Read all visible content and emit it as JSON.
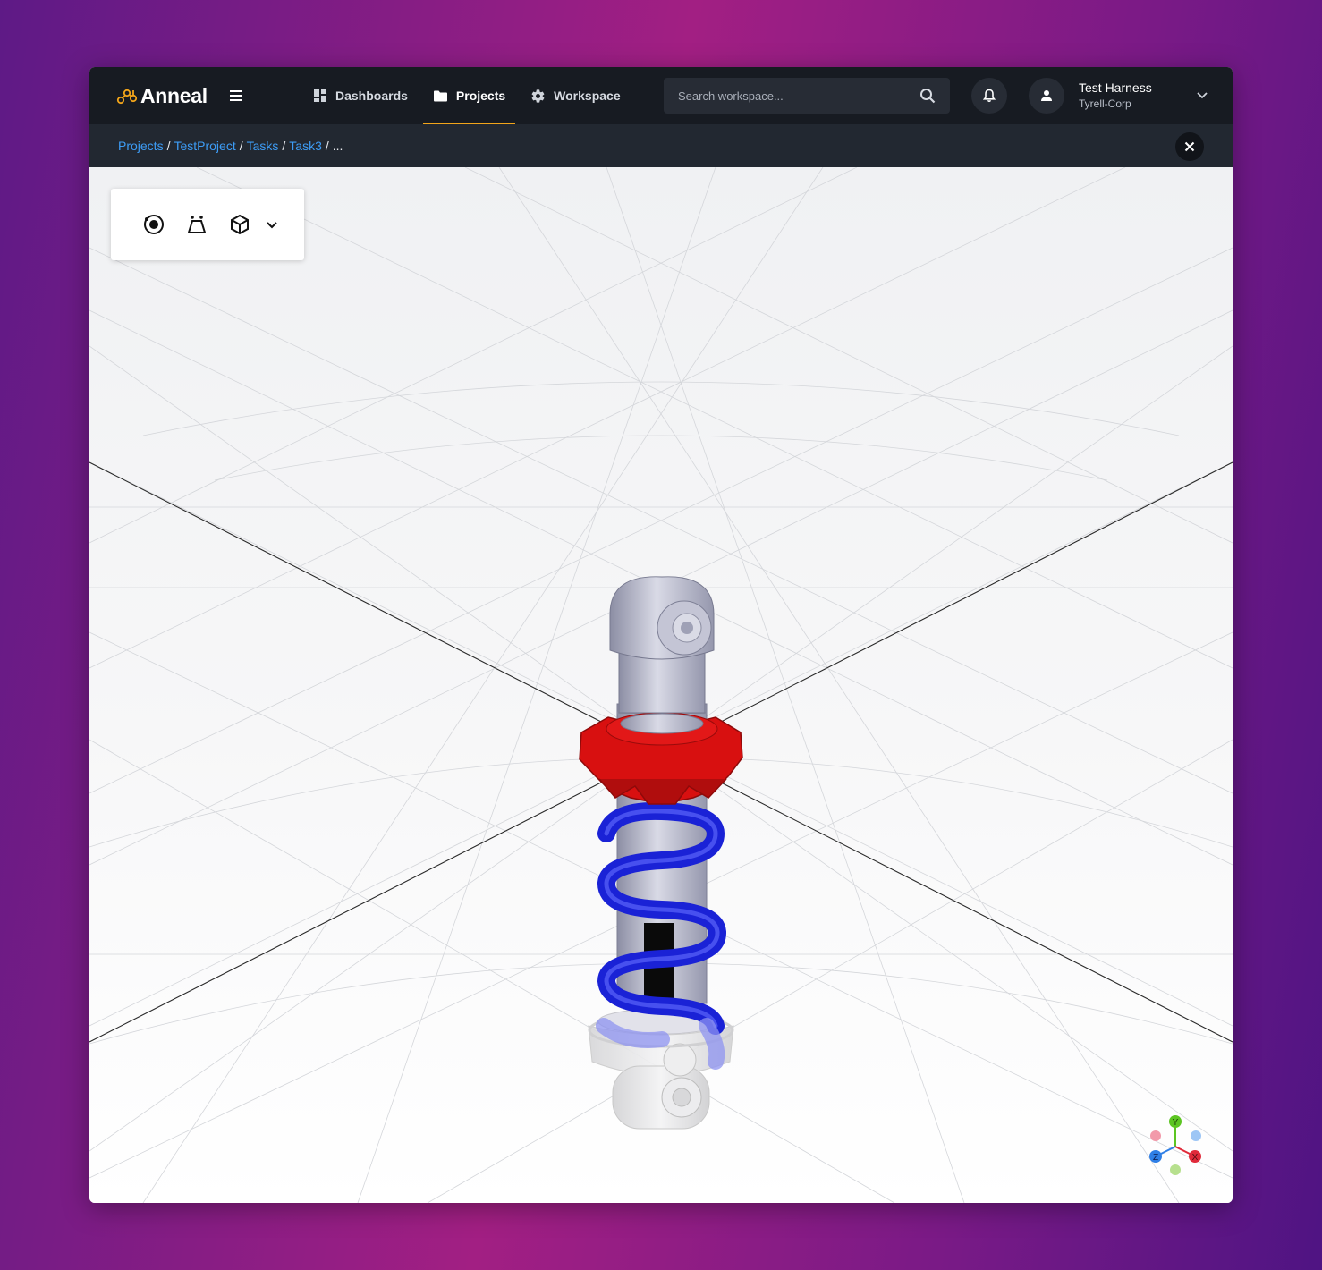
{
  "app": {
    "name": "Anneal"
  },
  "nav": {
    "items": [
      {
        "label": "Dashboards",
        "icon": "dashboard-icon",
        "active": false
      },
      {
        "label": "Projects",
        "icon": "folder-icon",
        "active": true
      },
      {
        "label": "Workspace",
        "icon": "gear-icon",
        "active": false
      }
    ]
  },
  "search": {
    "placeholder": "Search workspace...",
    "value": ""
  },
  "user": {
    "name": "Test Harness",
    "org": "Tyrell-Corp"
  },
  "breadcrumb": {
    "items": [
      "Projects",
      "TestProject",
      "Tasks",
      "Task3"
    ],
    "more": "..."
  },
  "toolbar": {
    "tools": [
      "orbit-icon",
      "perspective-icon",
      "cube-view-icon",
      "chevron-down-icon"
    ]
  },
  "gizmo": {
    "axes": [
      "Y",
      "X",
      "Z"
    ]
  },
  "colors": {
    "accent": "#f2a51a",
    "link": "#3d9cf5",
    "topbar": "#171b22",
    "spring": "#1a22d6",
    "collar": "#d81010"
  }
}
